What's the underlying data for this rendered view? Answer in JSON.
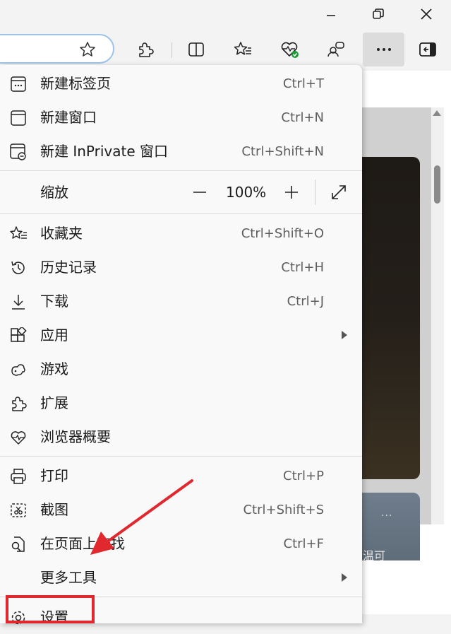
{
  "window": {
    "minimize_icon": "minimize-icon",
    "restore_icon": "restore-icon",
    "close_icon": "close-icon"
  },
  "toolbar": {
    "favorite_star_icon": "star-outline-icon",
    "extensions_icon": "puzzle-icon",
    "split_screen_icon": "split-screen-icon",
    "favorites_icon": "favorites-icon",
    "browser_essentials_icon": "heart-pulse-icon",
    "profile_icon": "people-icon",
    "more_icon": "ellipsis-icon",
    "sidebar_icon": "sidebar-icon"
  },
  "menu": {
    "items": [
      {
        "label": "新建标签页",
        "shortcut": "Ctrl+T"
      },
      {
        "label": "新建窗口",
        "shortcut": "Ctrl+N"
      },
      {
        "label": "新建 InPrivate 窗口",
        "shortcut": "Ctrl+Shift+N"
      },
      {
        "label": "缩放",
        "zoom": "100%"
      },
      {
        "label": "收藏夹",
        "shortcut": "Ctrl+Shift+O"
      },
      {
        "label": "历史记录",
        "shortcut": "Ctrl+H"
      },
      {
        "label": "下载",
        "shortcut": "Ctrl+J"
      },
      {
        "label": "应用",
        "shortcut": ""
      },
      {
        "label": "游戏",
        "shortcut": ""
      },
      {
        "label": "扩展",
        "shortcut": ""
      },
      {
        "label": "浏览器概要",
        "shortcut": ""
      },
      {
        "label": "打印",
        "shortcut": "Ctrl+P"
      },
      {
        "label": "截图",
        "shortcut": "Ctrl+Shift+S"
      },
      {
        "label": "在页面上查找",
        "shortcut": "Ctrl+F"
      },
      {
        "label": "更多工具",
        "shortcut": ""
      },
      {
        "label": "设置",
        "shortcut": ""
      }
    ]
  },
  "page": {
    "card_more": "···",
    "card_text": "温可"
  },
  "colors": {
    "accent_highlight": "#e0282e",
    "address_border": "#9dc3ea",
    "essentials_badge": "#1d9b37"
  }
}
